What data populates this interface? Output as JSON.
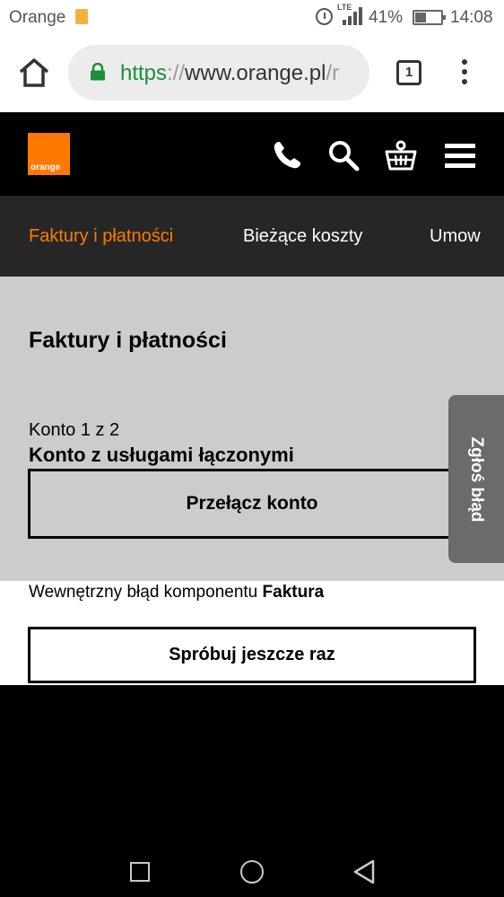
{
  "status_bar": {
    "carrier": "Orange",
    "network": "LTE",
    "battery_percent": "41%",
    "time": "14:08"
  },
  "browser": {
    "url_scheme": "https",
    "url_separator": "://",
    "url_host": "www.orange.pl",
    "url_rest": "/r",
    "tab_count": "1"
  },
  "header": {
    "logo_text": "orange",
    "brand_color": "#ff7900",
    "icons": [
      "phone-icon",
      "search-icon",
      "basket-icon",
      "hamburger-menu-icon"
    ]
  },
  "tabs": [
    {
      "label": "Faktury i płatności",
      "active": true
    },
    {
      "label": "Bieżące koszty",
      "active": false
    },
    {
      "label": "Umow",
      "active": false
    }
  ],
  "main": {
    "title": "Faktury i płatności",
    "account_index": "Konto 1 z 2",
    "account_name": "Konto z usługami łączonymi",
    "switch_button": "Przełącz konto",
    "error_prefix": "Wewnętrzny błąd komponentu ",
    "error_component": "Faktura",
    "retry_button": "Spróbuj jeszcze raz"
  },
  "feedback": {
    "label": "Zgłoś błąd"
  }
}
